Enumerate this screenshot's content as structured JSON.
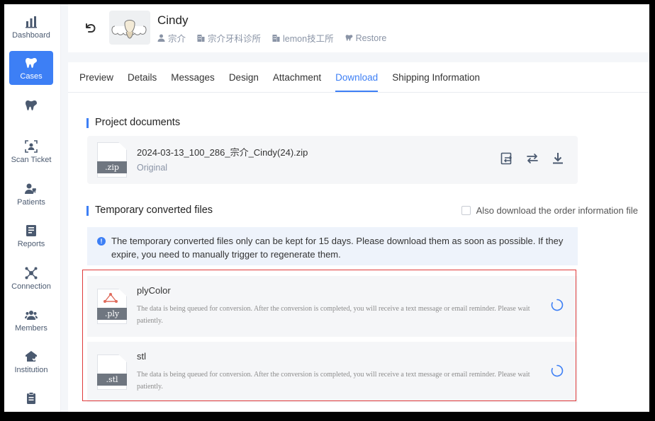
{
  "sidebar": {
    "items": [
      {
        "label": "Dashboard",
        "icon": "bar-chart-icon",
        "active": false
      },
      {
        "label": "Cases",
        "icon": "tooth-icon",
        "active": true
      },
      {
        "label": "",
        "icon": "tooth-icon",
        "active": false
      },
      {
        "label": "Scan Ticket",
        "icon": "scan-icon",
        "active": false
      },
      {
        "label": "Patients",
        "icon": "patients-icon",
        "active": false
      },
      {
        "label": "Reports",
        "icon": "report-icon",
        "active": false
      },
      {
        "label": "Connection",
        "icon": "connection-icon",
        "active": false
      },
      {
        "label": "Members",
        "icon": "members-icon",
        "active": false
      },
      {
        "label": "Institution",
        "icon": "institution-icon",
        "active": false
      },
      {
        "label": "",
        "icon": "clipboard-icon",
        "active": false
      }
    ]
  },
  "header": {
    "patient_name": "Cindy",
    "doctor": "宗介",
    "clinic": "宗介牙科诊所",
    "lab": "lemon技工所",
    "case_type": "Restore"
  },
  "tabs": [
    {
      "label": "Preview",
      "active": false
    },
    {
      "label": "Details",
      "active": false
    },
    {
      "label": "Messages",
      "active": false
    },
    {
      "label": "Design",
      "active": false
    },
    {
      "label": "Attachment",
      "active": false
    },
    {
      "label": "Download",
      "active": true
    },
    {
      "label": "Shipping Information",
      "active": false
    }
  ],
  "project_documents": {
    "title": "Project documents",
    "file": {
      "name": "2024-03-13_100_286_宗介_Cindy(24).zip",
      "sub": "Original",
      "ext": ".zip"
    }
  },
  "temp_files": {
    "title": "Temporary converted files",
    "checkbox_label": "Also download the order information file",
    "notice": "The temporary converted files only can be kept for 15 days. Please download them as soon as possible. If they expire, you need to manually trigger to regenerate them.",
    "items": [
      {
        "name": "plyColor",
        "ext": ".ply",
        "desc": "The data is being queued for conversion. After the conversion is completed, you will receive a text message or email reminder. Please wait patiently."
      },
      {
        "name": "stl",
        "ext": ".stl",
        "desc": "The data is being queued for conversion. After the conversion is completed, you will receive a text message or email reminder. Please wait patiently."
      }
    ]
  },
  "colors": {
    "accent": "#3d7ff5",
    "highlight": "#e03a3a",
    "text_muted": "#8a94a6"
  }
}
